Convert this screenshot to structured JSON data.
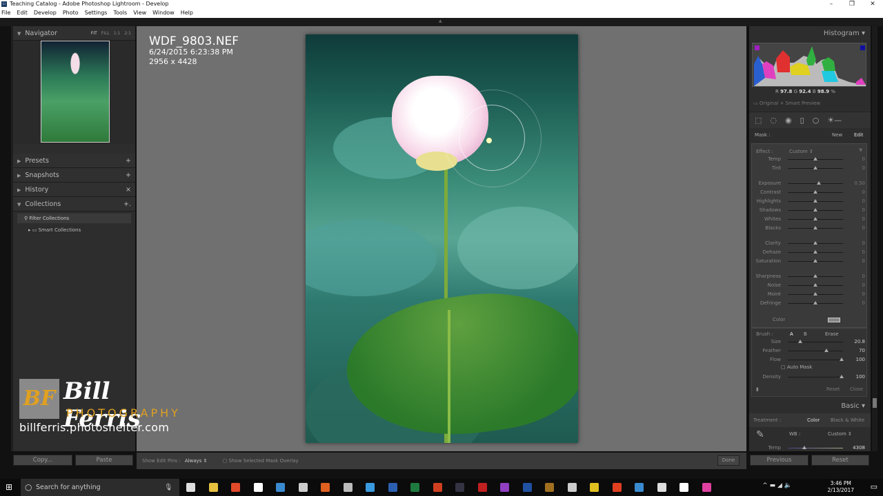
{
  "window": {
    "title": "Teaching Catalog - Adobe Photoshop Lightroom - Develop",
    "app_icon": "Lr",
    "controls": [
      "minimize-icon",
      "restore-icon",
      "close-icon"
    ]
  },
  "menu": [
    "File",
    "Edit",
    "Develop",
    "Photo",
    "Settings",
    "Tools",
    "View",
    "Window",
    "Help"
  ],
  "left": {
    "navigator": {
      "title": "Navigator",
      "options": [
        "FIT",
        "FILL",
        "1:1",
        "2:1"
      ]
    },
    "panels": [
      {
        "label": "Presets",
        "action": "+"
      },
      {
        "label": "Snapshots",
        "action": "+"
      },
      {
        "label": "History",
        "action": "×"
      },
      {
        "label": "Collections",
        "action": "+."
      }
    ],
    "collections": {
      "filter": "Filter Collections",
      "smart": "Smart Collections"
    },
    "copy": "Copy...",
    "paste": "Paste"
  },
  "photo_info": {
    "filename": "WDF_9803.NEF",
    "datetime": "6/24/2015 6:23:38 PM",
    "dimensions": "2956 x 4428"
  },
  "watermark": {
    "initials": "BF",
    "name": "Bill Ferris",
    "sub": "PHOTOGRAPHY",
    "url": "billferris.photoshelter.com"
  },
  "toolbar": {
    "pins_label": "Show Edit Pins :",
    "pins_value": "Always",
    "overlay_label": "Show Selected Mask Overlay",
    "done": "Done"
  },
  "right": {
    "histogram": {
      "title": "Histogram",
      "r_label": "R",
      "r": "97.8",
      "g_label": "G",
      "g": "92.4",
      "b_label": "B",
      "b": "98.9",
      "pct": "%",
      "preview": "Original + Smart Preview"
    },
    "mask": {
      "label": "Mask :",
      "new": "New",
      "edit": "Edit"
    },
    "effect": {
      "label": "Effect :",
      "value": "Custom"
    },
    "sliders": [
      {
        "label": "Temp",
        "value": "0",
        "level": 0.5
      },
      {
        "label": "Tint",
        "value": "0",
        "level": 0.5
      },
      {
        "label": "Exposure",
        "value": "0.50",
        "level": 0.56
      },
      {
        "label": "Contrast",
        "value": "0",
        "level": 0.5
      },
      {
        "label": "Highlights",
        "value": "0",
        "level": 0.5
      },
      {
        "label": "Shadows",
        "value": "0",
        "level": 0.5
      },
      {
        "label": "Whites",
        "value": "0",
        "level": 0.5
      },
      {
        "label": "Blacks",
        "value": "0",
        "level": 0.5
      },
      {
        "label": "Clarity",
        "value": "0",
        "level": 0.5
      },
      {
        "label": "Dehaze",
        "value": "0",
        "level": 0.5
      },
      {
        "label": "Saturation",
        "value": "0",
        "level": 0.5
      },
      {
        "label": "Sharpness",
        "value": "0",
        "level": 0.5
      },
      {
        "label": "Noise",
        "value": "0",
        "level": 0.5
      },
      {
        "label": "Moiré",
        "value": "0",
        "level": 0.5
      },
      {
        "label": "Defringe",
        "value": "0",
        "level": 0.5
      }
    ],
    "color_label": "Color",
    "brush": {
      "label": "Brush :",
      "a": "A",
      "b": "B",
      "erase": "Erase",
      "sliders": [
        {
          "label": "Size",
          "value": "20.8",
          "level": 0.23
        },
        {
          "label": "Feather",
          "value": "70",
          "level": 0.7
        },
        {
          "label": "Flow",
          "value": "100",
          "level": 0.98
        }
      ],
      "auto_mask": "Auto Mask",
      "density": {
        "label": "Density",
        "value": "100",
        "level": 0.98
      },
      "reset": "Reset",
      "close": "Close"
    },
    "basic": {
      "title": "Basic",
      "treatment": "Treatment :",
      "color": "Color",
      "bw": "Black & White",
      "wb_label": "WB :",
      "wb_value": "Custom",
      "temp_label": "Temp",
      "temp_value": "4308",
      "temp_level": 0.3
    },
    "previous": "Previous",
    "reset": "Reset"
  },
  "taskbar": {
    "search": "Search for anything",
    "time": "3:46 PM",
    "date": "2/13/2017"
  },
  "colors": {
    "panel": "#2d2d2d",
    "canvas": "#707070",
    "watermark_gold": "#e0a020"
  }
}
